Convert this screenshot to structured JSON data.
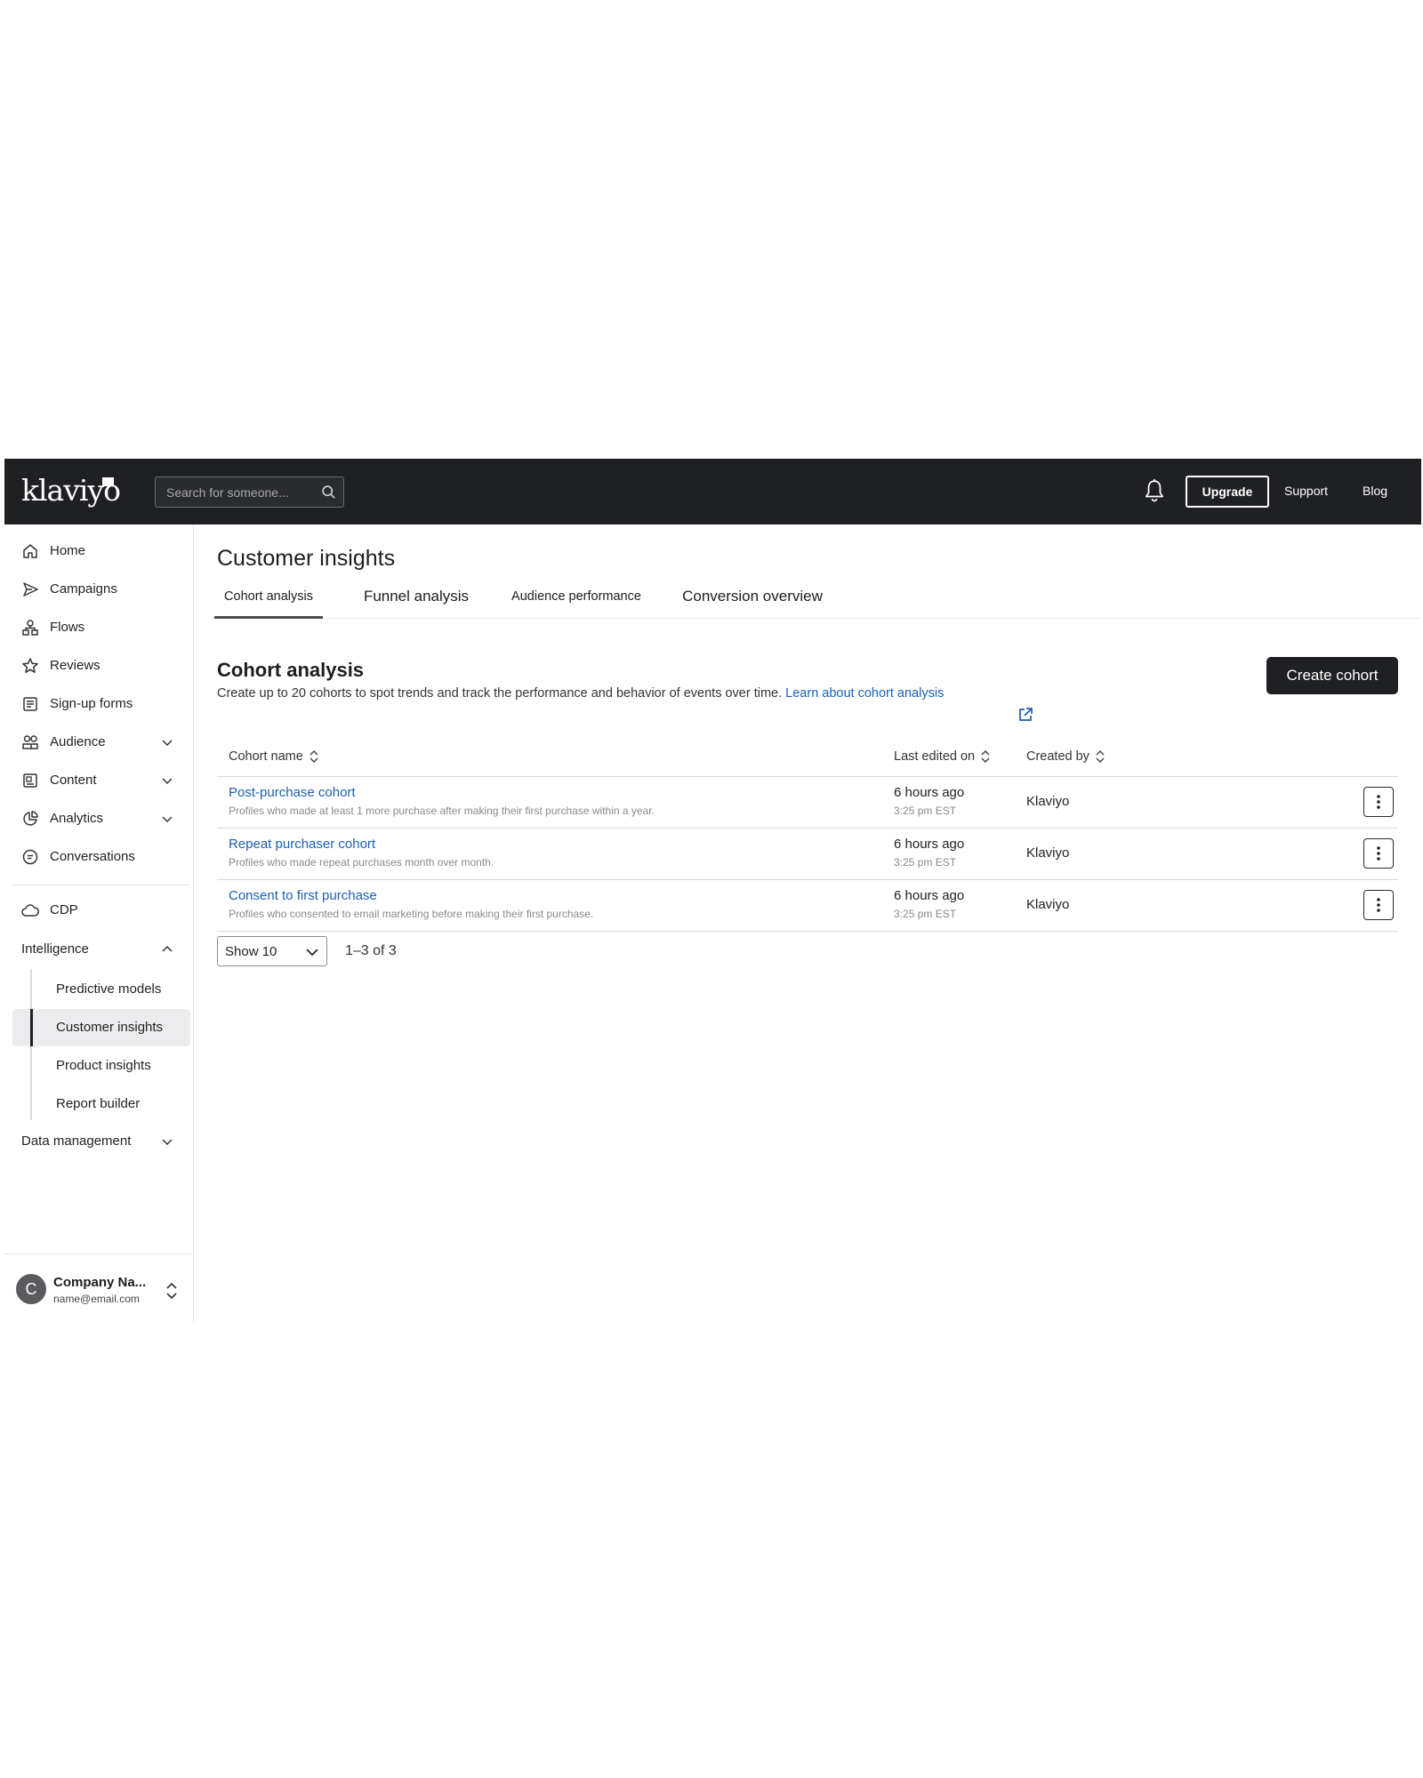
{
  "header": {
    "logo": "klaviyo",
    "search_placeholder": "Search for someone...",
    "upgrade_label": "Upgrade",
    "support_label": "Support",
    "blog_label": "Blog"
  },
  "sidebar": {
    "items": [
      {
        "label": "Home",
        "icon": "home-icon"
      },
      {
        "label": "Campaigns",
        "icon": "send-icon"
      },
      {
        "label": "Flows",
        "icon": "flow-icon"
      },
      {
        "label": "Reviews",
        "icon": "star-icon"
      },
      {
        "label": "Sign-up forms",
        "icon": "form-icon"
      },
      {
        "label": "Audience",
        "icon": "audience-icon",
        "expandable": true
      },
      {
        "label": "Content",
        "icon": "content-icon",
        "expandable": true
      },
      {
        "label": "Analytics",
        "icon": "analytics-icon",
        "expandable": true
      },
      {
        "label": "Conversations",
        "icon": "chat-icon"
      }
    ],
    "cdp_label": "CDP",
    "intelligence": {
      "label": "Intelligence",
      "items": [
        "Predictive models",
        "Customer insights",
        "Product insights",
        "Report builder"
      ],
      "active": "Customer insights"
    },
    "data_management_label": "Data management",
    "account": {
      "initial": "C",
      "name": "Company Na...",
      "email": "name@email.com"
    }
  },
  "main": {
    "page_title": "Customer insights",
    "tabs": [
      {
        "label": "Cohort analysis",
        "active": true
      },
      {
        "label": "Funnel analysis"
      },
      {
        "label": "Audience performance"
      },
      {
        "label": "Conversion overview"
      }
    ],
    "section_title": "Cohort analysis",
    "section_desc": "Create up to 20 cohorts to spot trends and track the performance and behavior of events over time.",
    "learn_link": "Learn about cohort analysis",
    "create_button": "Create cohort",
    "table": {
      "columns": [
        "Cohort name",
        "Last edited on",
        "Created by"
      ],
      "rows": [
        {
          "name": "Post-purchase cohort",
          "desc": "Profiles who made at least 1 more purchase after making their first purchase within a year.",
          "edited": "6 hours ago",
          "edited_time": "3:25 pm EST",
          "created_by": "Klaviyo"
        },
        {
          "name": "Repeat purchaser cohort",
          "desc": "Profiles who made repeat purchases month over month.",
          "edited": "6 hours ago",
          "edited_time": "3:25 pm EST",
          "created_by": "Klaviyo"
        },
        {
          "name": "Consent to first purchase",
          "desc": "Profiles who consented to email marketing before making their first purchase.",
          "edited": "6 hours ago",
          "edited_time": "3:25 pm EST",
          "created_by": "Klaviyo"
        }
      ]
    },
    "pagination": {
      "show_label": "Show 10",
      "range": "1–3 of 3"
    }
  },
  "colors": {
    "topbar": "#1f2023",
    "link": "#1a5fb4",
    "active_nav_bg": "#ececee"
  }
}
